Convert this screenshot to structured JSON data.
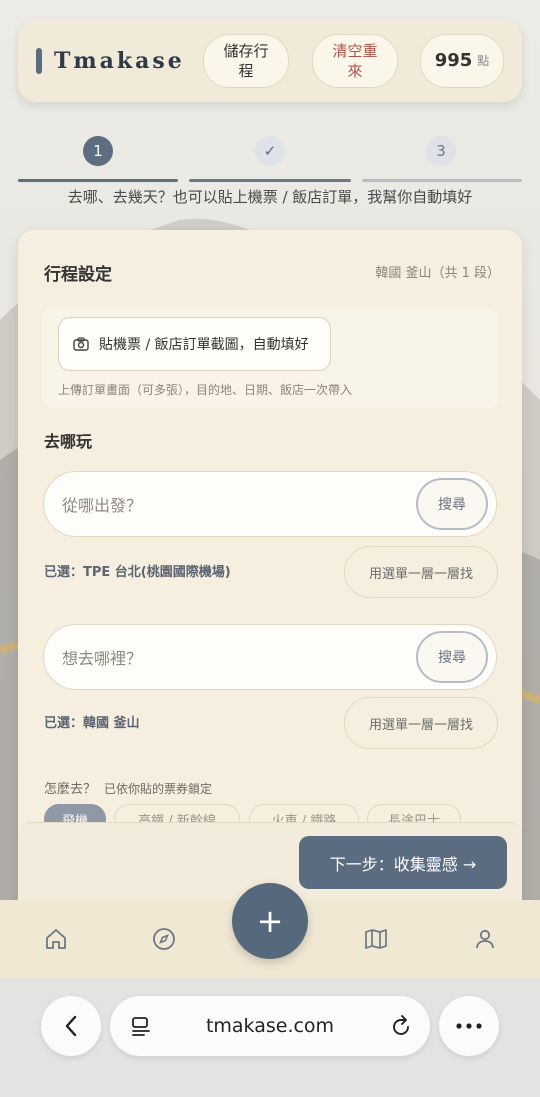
{
  "header": {
    "brand": "Tmakase",
    "save_label_1": "儲存行",
    "save_label_2": "程",
    "clear_label_1": "清空重",
    "clear_label_2": "來",
    "points_value": "995",
    "points_unit": "點"
  },
  "stepper": {
    "step1": "1",
    "step2": "✓",
    "step3": "3",
    "hint": "去哪、去幾天？也可以貼上機票 / 飯店訂單，我幫你自動填好"
  },
  "card": {
    "title": "行程設定",
    "subtitle": "韓國 釜山（共 1 段）",
    "upload_button": "貼機票 / 飯店訂單截圖，自動填好",
    "upload_note": "上傳訂單畫面（可多張），目的地、日期、飯店一次帶入",
    "section_where": "去哪玩",
    "origin_placeholder": "從哪出發？",
    "destination_placeholder": "想去哪裡？",
    "search_label": "搜尋",
    "origin_selected": "已選：TPE 台北(桃園國際機場)",
    "destination_selected": "已選：韓國 釜山",
    "menu_search_label": "用選單一層一層找",
    "how_label": "怎麼去？",
    "how_lock_note": "已依你貼的票券鎖定",
    "transport_options": [
      "飛機",
      "高鐵 / 新幹線",
      "火車 / 鐵路",
      "長途巴士"
    ]
  },
  "next_button": "下一步：收集靈感 →",
  "tabbar": {
    "fab_label": "+"
  },
  "browser": {
    "url": "tmakase.com"
  },
  "colors": {
    "accent": "#5b6b80",
    "clear_text": "#b0544a",
    "card_bg": "#f6efdf"
  }
}
